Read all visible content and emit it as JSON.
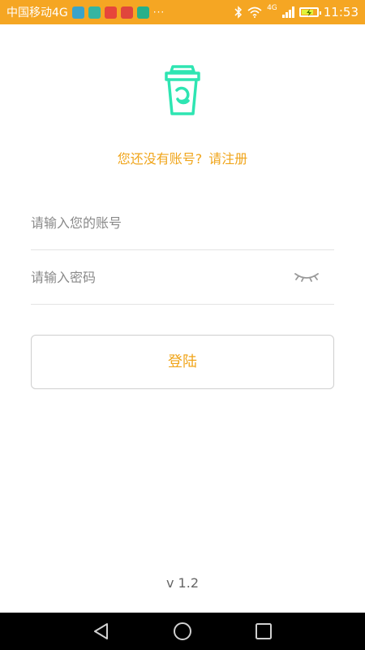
{
  "status_bar": {
    "carrier": "中国移动4G",
    "more": "···",
    "network": "4G",
    "time": "11:53",
    "colors": {
      "background": "#f5a623",
      "battery_charge": "#e2f23a"
    },
    "notification_icons": [
      {
        "name": "weather-icon",
        "color": "#3aa3c9"
      },
      {
        "name": "tree-icon",
        "color": "#35b5a2"
      },
      {
        "name": "lock-app-icon",
        "color": "#e7463a"
      },
      {
        "name": "alert-app-icon",
        "color": "#e0463c"
      },
      {
        "name": "shield-app-icon",
        "color": "#27b08a"
      }
    ],
    "battery_level": 0.8
  },
  "logo": {
    "icon": "cup-icon",
    "color": "#2ee5b2"
  },
  "register": {
    "prompt": "您还没有账号?",
    "link": "请注册",
    "color": "#f0a51b"
  },
  "login_form": {
    "account_placeholder": "请输入您的账号",
    "account_value": "",
    "password_placeholder": "请输入密码",
    "password_value": "",
    "eye_icon": "eye-closed-icon",
    "submit_label": "登陆"
  },
  "version": "v 1.2",
  "nav_bar": {
    "back": "back-triangle-icon",
    "home": "home-circle-icon",
    "recents": "recents-square-icon"
  }
}
